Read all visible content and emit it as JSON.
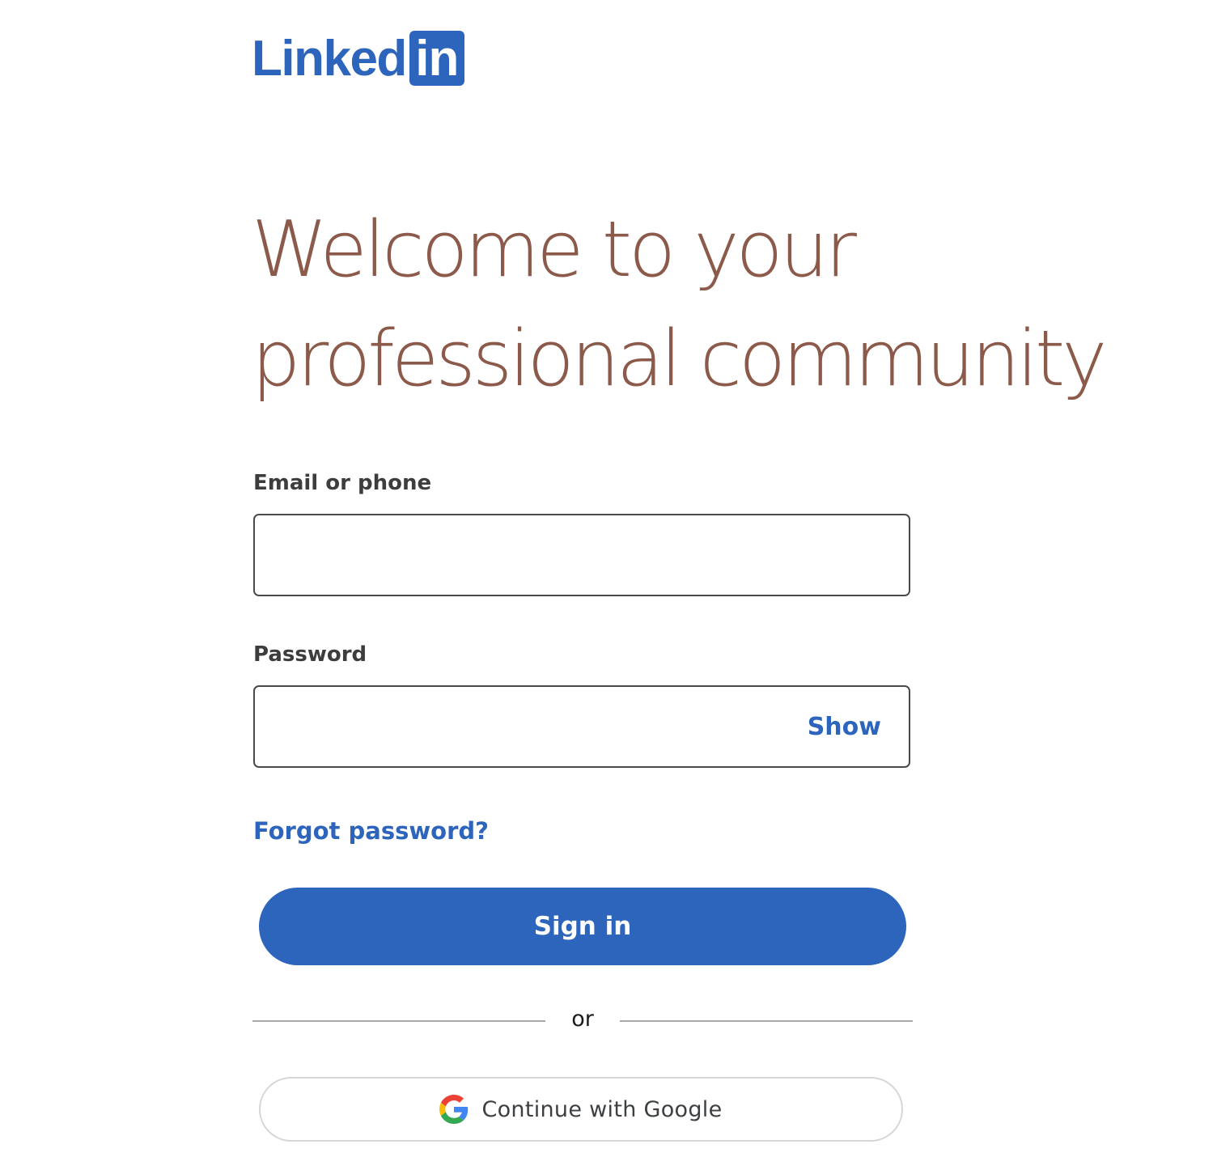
{
  "brand": {
    "logo_word": "Linked",
    "logo_box": "in",
    "color": "#2d64bc"
  },
  "headline": {
    "line1": "Welcome to your",
    "line2": "professional community",
    "color": "#8c5a4a"
  },
  "form": {
    "email_label": "Email or phone",
    "email_value": "",
    "password_label": "Password",
    "password_value": "",
    "show_label": "Show",
    "forgot_label": "Forgot password?",
    "signin_label": "Sign in"
  },
  "divider": {
    "text": "or"
  },
  "google": {
    "label": "Continue with Google",
    "icon": "google-g-icon"
  }
}
